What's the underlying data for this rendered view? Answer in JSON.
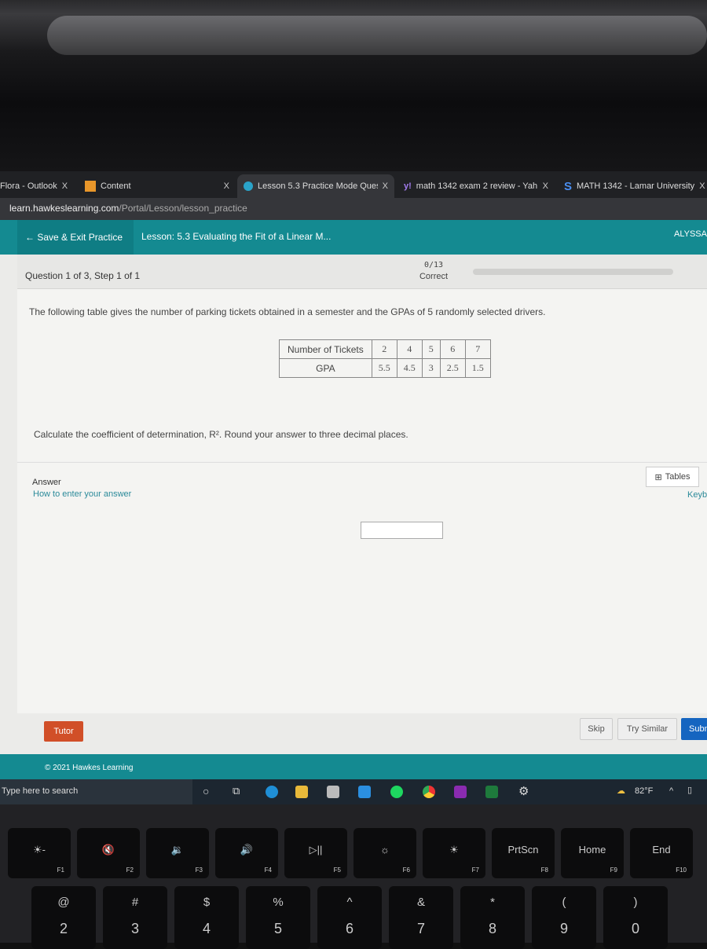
{
  "browser": {
    "tabs": [
      {
        "label": "Flora - Outlook",
        "close": "X"
      },
      {
        "label": "Content",
        "close": "X"
      },
      {
        "label": "Lesson 5.3 Practice Mode Quest",
        "close": "X",
        "active": true
      },
      {
        "label": "math 1342 exam 2 review - Yah",
        "close": "X"
      },
      {
        "label": "MATH 1342 - Lamar University",
        "close": "X"
      }
    ],
    "url_domain": "learn.hawkeslearning.com",
    "url_path": "/Portal/Lesson/lesson_practice"
  },
  "header": {
    "save_exit": "Save & Exit Practice",
    "lesson": "Lesson: 5.3 Evaluating the Fit of a Linear M...",
    "user": "ALYSSA",
    "accent": "#148a91"
  },
  "question": {
    "position": "Question 1 of 3,  Step 1 of 1",
    "score": "0/13",
    "score_label": "Correct",
    "prompt": "The following table gives the number of parking tickets obtained in a semester and the GPAs of 5 randomly selected drivers.",
    "table": {
      "rows": [
        {
          "header": "Number of Tickets",
          "values": [
            "2",
            "4",
            "5",
            "6",
            "7"
          ]
        },
        {
          "header": "GPA",
          "values": [
            "5.5",
            "4.5",
            "3",
            "2.5",
            "1.5"
          ]
        }
      ]
    },
    "instruction": "Calculate the coefficient of determination, R². Round your answer to three decimal places.",
    "answer_label": "Answer",
    "how_to": "How to enter your answer",
    "answer_value": "",
    "tables_button": "Tables",
    "keypad_button": "Keyb"
  },
  "actions": {
    "tutor": "Tutor",
    "skip": "Skip",
    "try_similar": "Try Similar",
    "submit": "Subm"
  },
  "footer": {
    "copyright": "© 2021 Hawkes Learning"
  },
  "taskbar": {
    "search_placeholder": "Type here to search",
    "weather": "82°F",
    "caret": "^"
  },
  "keyboard": {
    "fkeys": [
      {
        "sym": "☀-",
        "label": "F1"
      },
      {
        "sym": "🔇",
        "label": "F2"
      },
      {
        "sym": "🔉",
        "label": "F3"
      },
      {
        "sym": "🔊",
        "label": "F4"
      },
      {
        "sym": "▷||",
        "label": "F5"
      },
      {
        "sym": "☼",
        "label": "F6"
      },
      {
        "sym": "☀",
        "label": "F7"
      },
      {
        "sym": "PrtScn",
        "label": "F8"
      },
      {
        "sym": "Home",
        "label": "F9"
      },
      {
        "sym": "End",
        "label": "F10"
      }
    ],
    "numkeys": [
      {
        "top": "@",
        "bottom": "2"
      },
      {
        "top": "#",
        "bottom": "3"
      },
      {
        "top": "$",
        "bottom": "4"
      },
      {
        "top": "%",
        "bottom": "5"
      },
      {
        "top": "^",
        "bottom": "6"
      },
      {
        "top": "&",
        "bottom": "7"
      },
      {
        "top": "*",
        "bottom": "8"
      },
      {
        "top": "(",
        "bottom": "9"
      },
      {
        "top": ")",
        "bottom": "0"
      }
    ]
  }
}
